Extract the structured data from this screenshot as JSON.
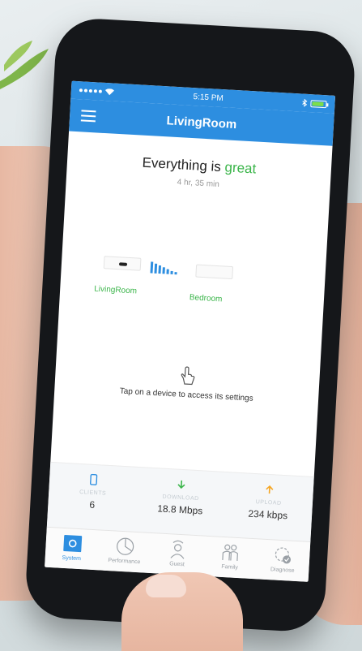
{
  "status_bar": {
    "time": "5:15 PM"
  },
  "nav": {
    "title": "LivingRoom"
  },
  "summary": {
    "prefix": "Everything is",
    "highlight": "great",
    "uptime": "4 hr, 35 min"
  },
  "topology": {
    "devices": [
      {
        "label": "LivingRoom"
      },
      {
        "label": "Bedroom"
      }
    ],
    "hint": "Tap on a device to access its settings"
  },
  "stats": [
    {
      "label": "CLIENTS",
      "value": "6",
      "icon": "phone-icon"
    },
    {
      "label": "DOWNLOAD",
      "value": "18.8 Mbps",
      "icon": "arrow-down-icon"
    },
    {
      "label": "UPLOAD",
      "value": "234 kbps",
      "icon": "arrow-up-icon"
    }
  ],
  "tabs": [
    {
      "label": "System",
      "icon": "system-icon",
      "active": true
    },
    {
      "label": "Performance",
      "icon": "performance-icon",
      "active": false
    },
    {
      "label": "Guest",
      "icon": "guest-icon",
      "active": false
    },
    {
      "label": "Family",
      "icon": "family-icon",
      "active": false
    },
    {
      "label": "Diagnose",
      "icon": "diagnose-icon",
      "active": false
    }
  ],
  "colors": {
    "accent": "#2d8ee0",
    "good": "#3bb54a",
    "upload": "#f5a623",
    "download": "#3bb54a"
  }
}
